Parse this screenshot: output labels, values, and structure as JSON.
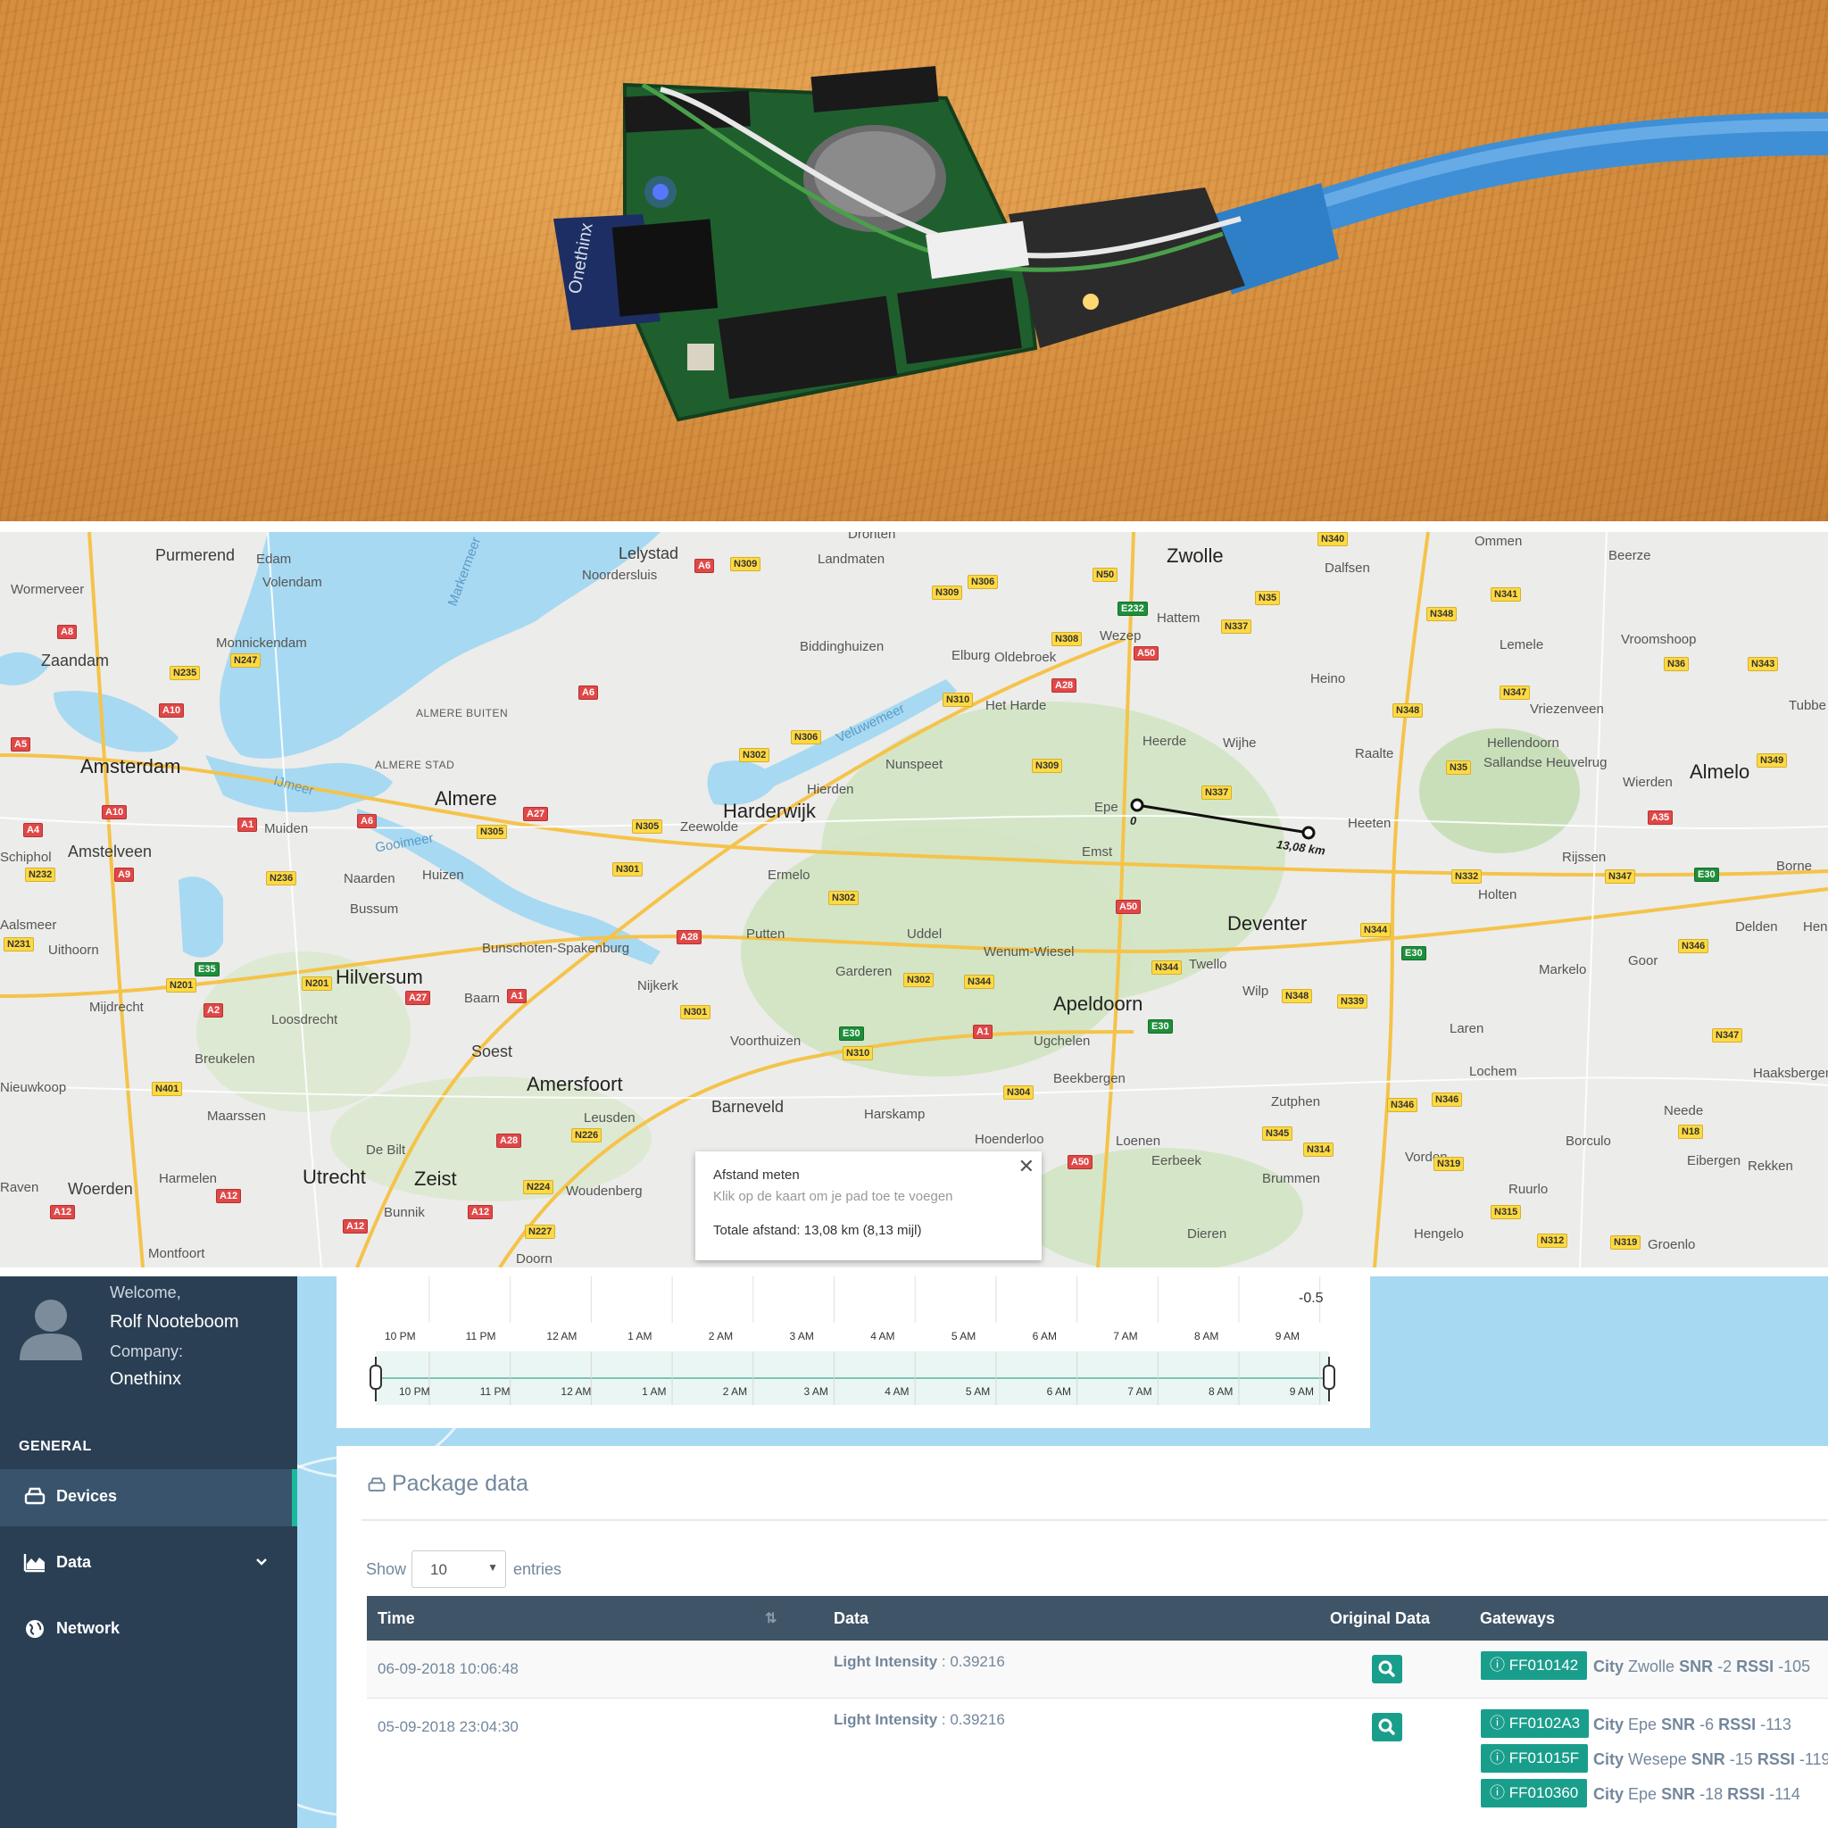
{
  "map": {
    "places_big": [
      {
        "name": "Amsterdam"
      },
      {
        "name": "Almere"
      },
      {
        "name": "Harderwijk"
      },
      {
        "name": "Hilversum"
      },
      {
        "name": "Amersfoort"
      },
      {
        "name": "Utrecht"
      },
      {
        "name": "Apeldoorn"
      },
      {
        "name": "Deventer"
      },
      {
        "name": "Zwolle"
      },
      {
        "name": "Almelo"
      },
      {
        "name": "Lelystad"
      },
      {
        "name": "Zeist"
      },
      {
        "name": "Soest"
      },
      {
        "name": "Barneveld"
      }
    ],
    "places": [
      "Purmerend",
      "Edam",
      "Volendam",
      "Wormerveer",
      "Zaandam",
      "Monnickendam",
      "Amstelveen",
      "Muiden",
      "Naarden",
      "Huizen",
      "Bussum",
      "Uithoorn",
      "Mijdrecht",
      "Loosdrecht",
      "Breukelen",
      "Maarssen",
      "Woerden",
      "Harmelen",
      "De Bilt",
      "Bunnik",
      "Leusden",
      "Woudenberg",
      "Doorn",
      "Montfoort",
      "Baarn",
      "Bunschoten-Spakenburg",
      "Nijkerk",
      "Putten",
      "Ermelo",
      "Zeewolde",
      "Hierden",
      "Nunspeet",
      "Elburg",
      "Oldebroek",
      "Biddinghuizen",
      "Landmaten",
      "Noordersluis",
      "Het Harde",
      "Wezep",
      "Hattem",
      "Heerde",
      "Wijhe",
      "Epe",
      "Emst",
      "Heeten",
      "Raalte",
      "Heino",
      "Dalfsen",
      "Ommen",
      "Beerze",
      "Lemele",
      "Vroomshoop",
      "Vriezenveen",
      "Hellendoorn",
      "Sallandse Heuvelrug",
      "Wierden",
      "Rijssen",
      "Holten",
      "Markelo",
      "Goor",
      "Delden",
      "Borne",
      "Laren",
      "Lochem",
      "Zutphen",
      "Twello",
      "Wilp",
      "Wenum-Wiesel",
      "Uddel",
      "Garderen",
      "Voorthuizen",
      "Harskamp",
      "Hoenderloo",
      "Ugchelen",
      "Beekbergen",
      "Loenen",
      "Eerbeek",
      "Brummen",
      "Dieren",
      "Hengelo",
      "Vorden",
      "Ruurlo",
      "Borculo",
      "Neede",
      "Eibergen",
      "Rekken",
      "Groenlo",
      "Haaksbergen",
      "Tubbe",
      "Hen",
      "Schiphol",
      "Aalsmeer",
      "Nieuwkoop",
      "Raven",
      "Veluwemeer",
      "Gooimeer",
      "IJmeer",
      "Markermeer",
      "Dronten"
    ],
    "small_caps": [
      "ALMERE BUITEN",
      "ALMERE STAD"
    ],
    "roads_n": [
      "N235",
      "N247",
      "N232",
      "N201",
      "N231",
      "N401",
      "N236",
      "N201",
      "N305",
      "N301",
      "N302",
      "N302",
      "N305",
      "N306",
      "N309",
      "N309",
      "N310",
      "N306",
      "N308",
      "N309",
      "N344",
      "N302",
      "N344",
      "N301",
      "N310",
      "N304",
      "N226",
      "N224",
      "N227",
      "N340",
      "N50",
      "N35",
      "N337",
      "N348",
      "N341",
      "N347",
      "N348",
      "N36",
      "N343",
      "N35",
      "N349",
      "N337",
      "N332",
      "N347",
      "N344",
      "N339",
      "N348",
      "N346",
      "N347",
      "N346",
      "N346",
      "N18",
      "N345",
      "N314",
      "N319",
      "N315",
      "N312",
      "N319"
    ],
    "roads_a": [
      "A8",
      "A10",
      "A5",
      "A10",
      "A4",
      "A9",
      "A1",
      "A6",
      "A27",
      "A6",
      "A2",
      "A27",
      "A1",
      "A28",
      "A28",
      "A12",
      "A12",
      "A12",
      "A12",
      "A1",
      "A50",
      "A28",
      "A50",
      "A50",
      "A35",
      "A6"
    ],
    "roads_e": [
      "E35",
      "E30",
      "E232",
      "E30",
      "E30",
      "E30"
    ],
    "measure": {
      "start_label": "0",
      "end_label": "13,08 km"
    },
    "popup": {
      "title": "Afstand meten",
      "hint": "Klik op de kaart om je pad toe te voegen",
      "total": "Totale afstand: 13,08 km (8,13 mijl)"
    }
  },
  "sidebar": {
    "welcome_label": "Welcome,",
    "user_name": "Rolf Nooteboom",
    "company_label": "Company:",
    "company_name": "Onethinx",
    "section_general": "GENERAL",
    "items": [
      {
        "label": "Devices",
        "active": true
      },
      {
        "label": "Data"
      },
      {
        "label": "Network"
      }
    ]
  },
  "timeline": {
    "y_value": "-0.5",
    "ticks": [
      "10 PM",
      "11 PM",
      "12 AM",
      "1 AM",
      "2 AM",
      "3 AM",
      "4 AM",
      "5 AM",
      "6 AM",
      "7 AM",
      "8 AM",
      "9 AM"
    ]
  },
  "package": {
    "title": "Package data",
    "show_label": "Show",
    "entries_value": "10",
    "entries_label": "entries",
    "columns": [
      "Time",
      "Data",
      "Original Data",
      "Gateways"
    ],
    "rows": [
      {
        "time": "06-09-2018 10:06:48",
        "data_key": "Light Intensity",
        "data_val": " : 0.39216",
        "gateways": [
          {
            "id": "FF010142",
            "city_lbl": "City",
            "city": "Zwolle",
            "snr_lbl": "SNR",
            "snr": "-2",
            "rssi_lbl": "RSSI",
            "rssi": "-105"
          }
        ]
      },
      {
        "time": "05-09-2018 23:04:30",
        "data_key": "Light Intensity",
        "data_val": " : 0.39216",
        "gateways": [
          {
            "id": "FF0102A3",
            "city_lbl": "City",
            "city": "Epe",
            "snr_lbl": "SNR",
            "snr": "-6",
            "rssi_lbl": "RSSI",
            "rssi": "-113"
          },
          {
            "id": "FF01015F",
            "city_lbl": "City",
            "city": "Wesepe",
            "snr_lbl": "SNR",
            "snr": "-15",
            "rssi_lbl": "RSSI",
            "rssi": "-119"
          },
          {
            "id": "FF010360",
            "city_lbl": "City",
            "city": "Epe",
            "snr_lbl": "SNR",
            "snr": "-18",
            "rssi_lbl": "RSSI",
            "rssi": "-114"
          }
        ]
      }
    ]
  },
  "colors": {
    "accent": "#1a9e8c",
    "sidebar": "#2a3f54",
    "table_head": "#405467",
    "water": "#a7d9f2",
    "active_bar": "#1abb9c"
  }
}
